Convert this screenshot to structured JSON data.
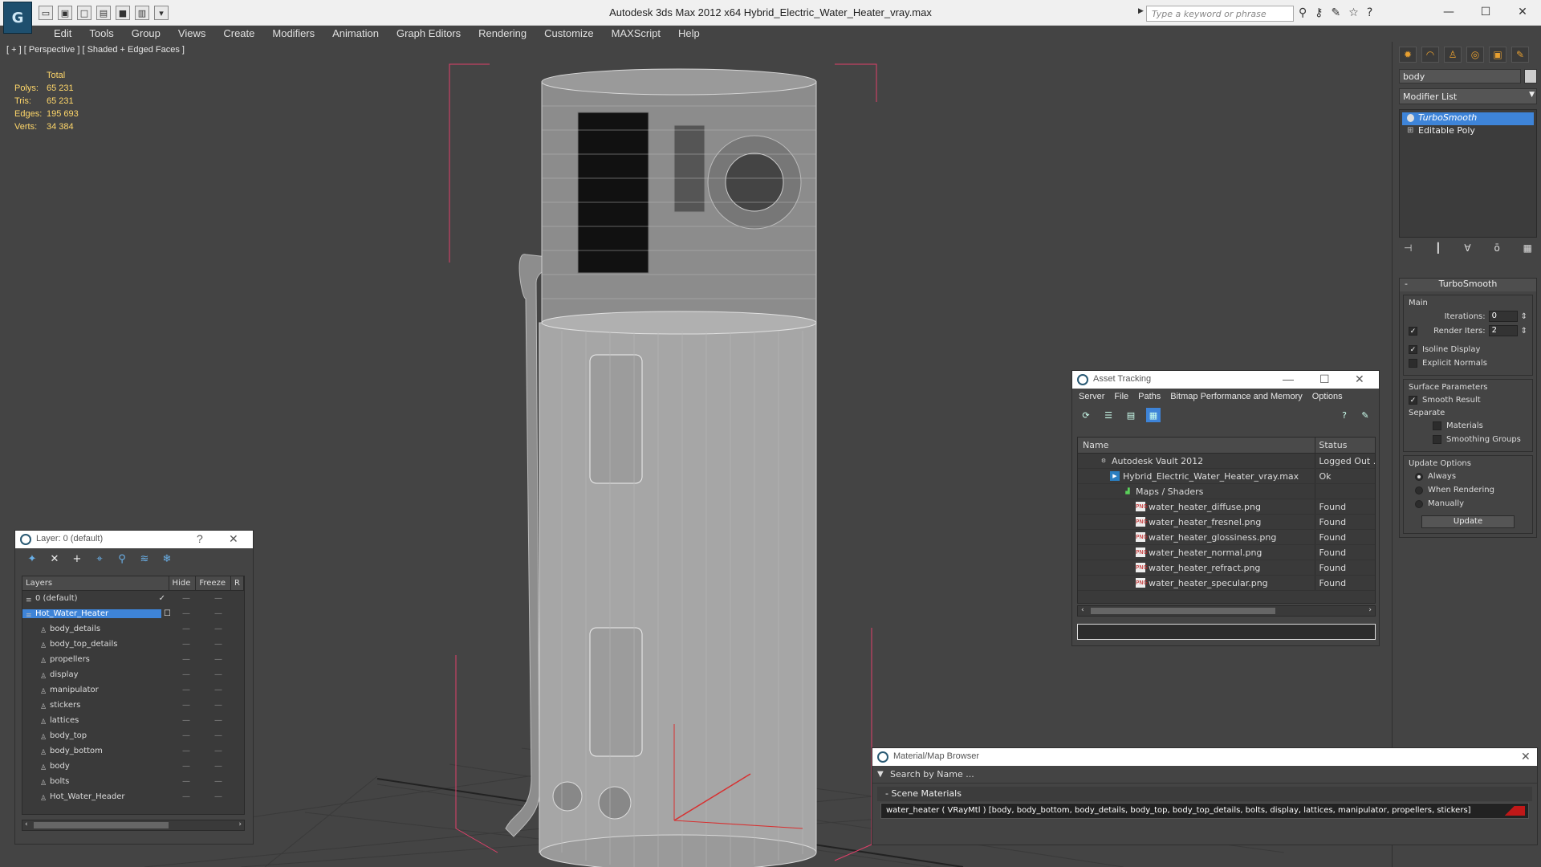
{
  "titlebar": {
    "title": "Autodesk 3ds Max  2012 x64      Hybrid_Electric_Water_Heater_vray.max",
    "search_placeholder": "Type a keyword or phrase",
    "logo": "3ds-max-logo",
    "minimize": "—",
    "maximize": "☐",
    "close": "✕"
  },
  "menu": [
    "Edit",
    "Tools",
    "Group",
    "Views",
    "Create",
    "Modifiers",
    "Animation",
    "Graph Editors",
    "Rendering",
    "Customize",
    "MAXScript",
    "Help"
  ],
  "viewport": {
    "label": "[ + ] [ Perspective ] [ Shaded + Edged Faces ]",
    "stats": {
      "header": "Total",
      "rows": [
        {
          "label": "Polys:",
          "value": "65 231"
        },
        {
          "label": "Tris:",
          "value": "65 231"
        },
        {
          "label": "Edges:",
          "value": "195 693"
        },
        {
          "label": "Verts:",
          "value": "34 384"
        }
      ]
    }
  },
  "command_panel": {
    "object_name": "body",
    "modifier_list": "Modifier List",
    "stack": [
      {
        "label": "TurboSmooth",
        "active": true
      },
      {
        "label": "Editable Poly",
        "active": false
      }
    ],
    "rollout": {
      "title": "TurboSmooth",
      "main_label": "Main",
      "iterations_label": "Iterations:",
      "iterations_value": "0",
      "render_iters_label": "Render Iters:",
      "render_iters_value": "2",
      "render_iters_checked": true,
      "isoline_label": "Isoline Display",
      "isoline_checked": true,
      "explicit_label": "Explicit Normals",
      "explicit_checked": false,
      "surface_label": "Surface Parameters",
      "smooth_label": "Smooth Result",
      "smooth_checked": true,
      "separate_label": "Separate",
      "materials_label": "Materials",
      "smoothing_label": "Smoothing Groups",
      "update_options_label": "Update Options",
      "always_label": "Always",
      "when_rendering_label": "When Rendering",
      "manually_label": "Manually",
      "update_button": "Update"
    }
  },
  "layer_manager": {
    "title": "Layer: 0 (default)",
    "help": "?",
    "close": "✕",
    "columns": [
      "Layers",
      "Hide",
      "Freeze",
      "R"
    ],
    "rows": [
      {
        "name": "0 (default)",
        "child": false,
        "selected": false,
        "mark": "✓"
      },
      {
        "name": "Hot_Water_Heater",
        "child": false,
        "selected": true,
        "mark": "☐"
      },
      {
        "name": "body_details",
        "child": true
      },
      {
        "name": "body_top_details",
        "child": true
      },
      {
        "name": "propellers",
        "child": true
      },
      {
        "name": "display",
        "child": true
      },
      {
        "name": "manipulator",
        "child": true
      },
      {
        "name": "stickers",
        "child": true
      },
      {
        "name": "lattices",
        "child": true
      },
      {
        "name": "body_top",
        "child": true
      },
      {
        "name": "body_bottom",
        "child": true
      },
      {
        "name": "body",
        "child": true
      },
      {
        "name": "bolts",
        "child": true
      },
      {
        "name": "Hot_Water_Header",
        "child": true
      }
    ]
  },
  "asset_tracking": {
    "title": "Asset Tracking",
    "menu": [
      "Server",
      "File",
      "Paths",
      "Bitmap Performance and Memory",
      "Options"
    ],
    "columns": {
      "name": "Name",
      "status": "Status"
    },
    "rows": [
      {
        "name": "Autodesk Vault 2012",
        "status": "Logged Out .",
        "indent": 1,
        "icon": "vault"
      },
      {
        "name": "Hybrid_Electric_Water_Heater_vray.max",
        "status": "Ok",
        "indent": 2,
        "icon": "max"
      },
      {
        "name": "Maps / Shaders",
        "status": "",
        "indent": 3,
        "icon": "maps"
      },
      {
        "name": "water_heater_diffuse.png",
        "status": "Found",
        "indent": 4,
        "icon": "png"
      },
      {
        "name": "water_heater_fresnel.png",
        "status": "Found",
        "indent": 4,
        "icon": "png"
      },
      {
        "name": "water_heater_glossiness.png",
        "status": "Found",
        "indent": 4,
        "icon": "png"
      },
      {
        "name": "water_heater_normal.png",
        "status": "Found",
        "indent": 4,
        "icon": "png"
      },
      {
        "name": "water_heater_refract.png",
        "status": "Found",
        "indent": 4,
        "icon": "png"
      },
      {
        "name": "water_heater_specular.png",
        "status": "Found",
        "indent": 4,
        "icon": "png"
      }
    ]
  },
  "material_browser": {
    "title": "Material/Map Browser",
    "search_placeholder": "Search by Name ...",
    "section": "Scene Materials",
    "entry": "water_heater ( VRayMtl ) [body, body_bottom, body_details, body_top, body_top_details, bolts, display, lattices, manipulator, propellers, stickers]"
  },
  "colors": {
    "viewport_bg": "#444444",
    "selection": "#3e84d8",
    "stats": "#ffd76a",
    "bounding_box": "#e0406a"
  }
}
